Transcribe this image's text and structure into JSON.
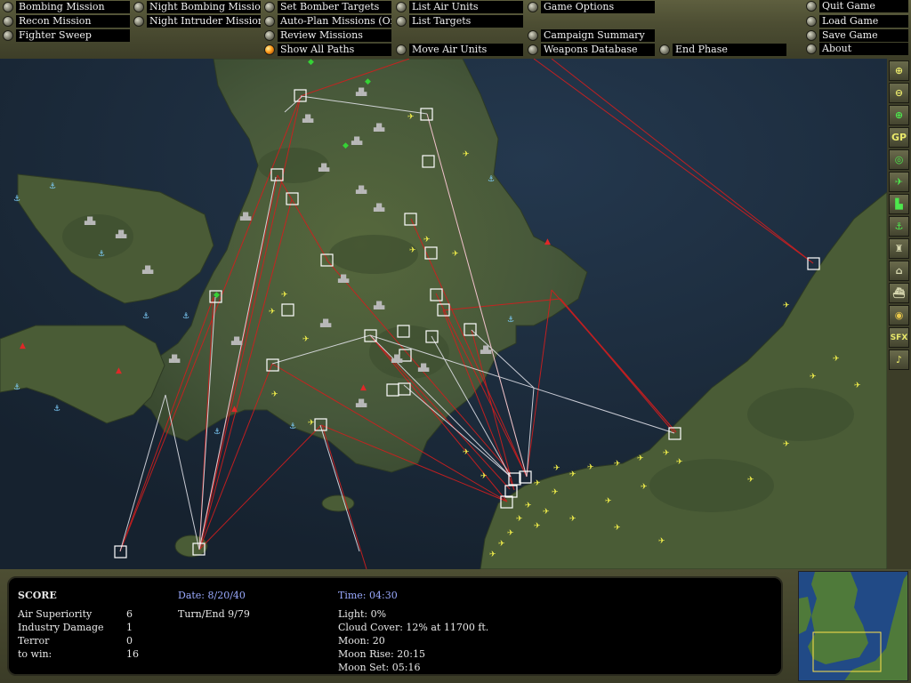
{
  "menu": {
    "bombing_mission": "Bombing Mission",
    "recon_mission": "Recon Mission",
    "fighter_sweep": "Fighter Sweep",
    "night_bombing_mission": "Night Bombing Mission",
    "night_intruder_mission": "Night Intruder Mission",
    "set_bomber_targets": "Set Bomber Targets",
    "auto_plan_missions": "Auto-Plan Missions (Off)",
    "review_missions": "Review Missions",
    "show_all_paths": "Show All Paths",
    "list_air_units": "List Air Units",
    "list_targets": "List Targets",
    "move_air_units": "Move Air Units",
    "game_options": "Game Options",
    "campaign_summary": "Campaign Summary",
    "weapons_database": "Weapons Database",
    "end_phase": "End Phase",
    "quit_game": "Quit Game",
    "load_game": "Load Game",
    "save_game": "Save Game",
    "about": "About"
  },
  "toolbar": {
    "gp_label": "GP",
    "sfx_label": "SFX"
  },
  "status": {
    "score_title": "SCORE",
    "air_superiority_label": "Air Superiority",
    "air_superiority_value": "6",
    "industry_damage_label": "Industry Damage",
    "industry_damage_value": "1",
    "terror_label": "Terror",
    "terror_value": "0",
    "to_win_label": "to win:",
    "to_win_value": "16",
    "date": "Date: 8/20/40",
    "turn_end": "Turn/End  9/79",
    "time": "Time: 04:30",
    "light": "Light: 0%",
    "cloud_cover": "Cloud Cover: 12% at 11700 ft.",
    "moon": "Moon: 20",
    "moon_rise": "Moon Rise: 20:15",
    "moon_set": "Moon Set: 05:16"
  },
  "colors": {
    "sea": "#1c2c3e",
    "land": "#4b5d35",
    "red_path": "#d21e1e",
    "white_path": "#e8e8f0",
    "airfield_box": "#ffffff",
    "status_text": "#e8e8e8",
    "status_blue": "#9aaaff"
  }
}
